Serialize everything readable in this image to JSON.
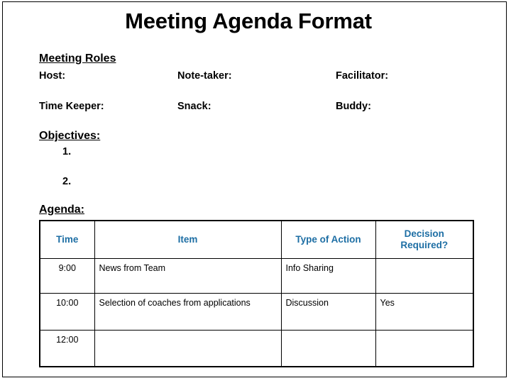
{
  "slide": {
    "title": "Meeting Agenda Format"
  },
  "roles": {
    "heading": "Meeting Roles",
    "labels": [
      {
        "id": "host",
        "text": "Host:"
      },
      {
        "id": "note-taker",
        "text": "Note-taker:"
      },
      {
        "id": "facilitator",
        "text": "Facilitator:"
      },
      {
        "id": "time-keeper",
        "text": "Time Keeper:"
      },
      {
        "id": "snack",
        "text": "Snack:"
      },
      {
        "id": "buddy",
        "text": "Buddy:"
      }
    ]
  },
  "objectives": {
    "heading": "Objectives:",
    "items": [
      "1.",
      "2."
    ]
  },
  "agenda": {
    "heading": "Agenda:",
    "header_color": "#1d6ea4",
    "columns": [
      {
        "id": "time",
        "label": "Time"
      },
      {
        "id": "item",
        "label": "Item"
      },
      {
        "id": "action",
        "label": "Type of Action"
      },
      {
        "id": "decision",
        "label_line1": "Decision",
        "label_line2": "Required?"
      }
    ],
    "rows": [
      {
        "time": "9:00",
        "item": "News from Team",
        "action": "Info Sharing",
        "decision": ""
      },
      {
        "time": "10:00",
        "item": "Selection of coaches from applications",
        "action": "Discussion",
        "decision": "Yes"
      },
      {
        "time": "12:00",
        "item": "",
        "action": "",
        "decision": ""
      }
    ]
  }
}
